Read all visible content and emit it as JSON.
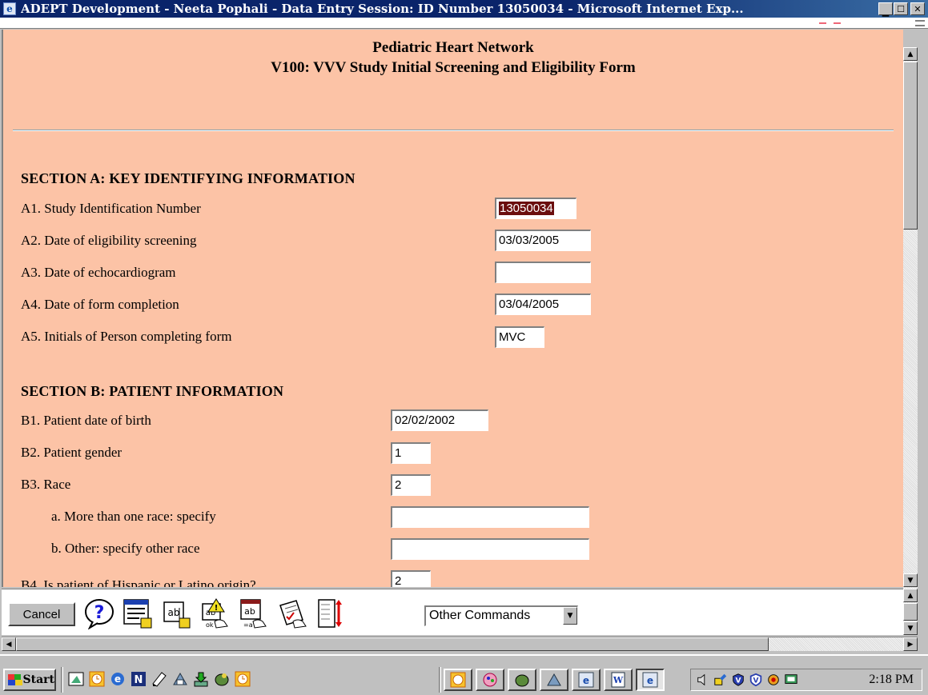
{
  "window": {
    "title": "ADEPT Development - Neeta Pophali - Data Entry Session: ID Number 13050034 - Microsoft Internet Exp..."
  },
  "form": {
    "org": "Pediatric Heart Network",
    "title": "V100: VVV Study Initial Screening and Eligibility Form",
    "section_a": {
      "title": "SECTION A: KEY IDENTIFYING INFORMATION",
      "rows": [
        {
          "label": "A1. Study Identification Number",
          "value": "13050034"
        },
        {
          "label": "A2. Date of eligibility screening",
          "value": "03/03/2005"
        },
        {
          "label": "A3. Date of echocardiogram",
          "value": ""
        },
        {
          "label": "A4. Date of form completion",
          "value": "03/04/2005"
        },
        {
          "label": "A5. Initials of Person completing form",
          "value": "MVC"
        }
      ]
    },
    "section_b": {
      "title": "SECTION B: PATIENT INFORMATION",
      "rows": [
        {
          "label": "B1. Patient date of birth",
          "value": "02/02/2002"
        },
        {
          "label": "B2. Patient gender",
          "value": "1"
        },
        {
          "label": "B3. Race",
          "value": "2"
        },
        {
          "label": "a. More than one race: specify",
          "value": ""
        },
        {
          "label": "b. Other: specify other race",
          "value": ""
        },
        {
          "label": "B4. Is patient of Hispanic or Latino origin?",
          "value": "2"
        }
      ]
    }
  },
  "commands": {
    "cancel": "Cancel",
    "other_commands": "Other Commands"
  },
  "taskbar": {
    "start": "Start",
    "clock": "2:18 PM"
  },
  "colors": {
    "form_bg": "#fcc3a6",
    "title_bar": "#0a246a",
    "selected_field": "#6b0e0e"
  }
}
